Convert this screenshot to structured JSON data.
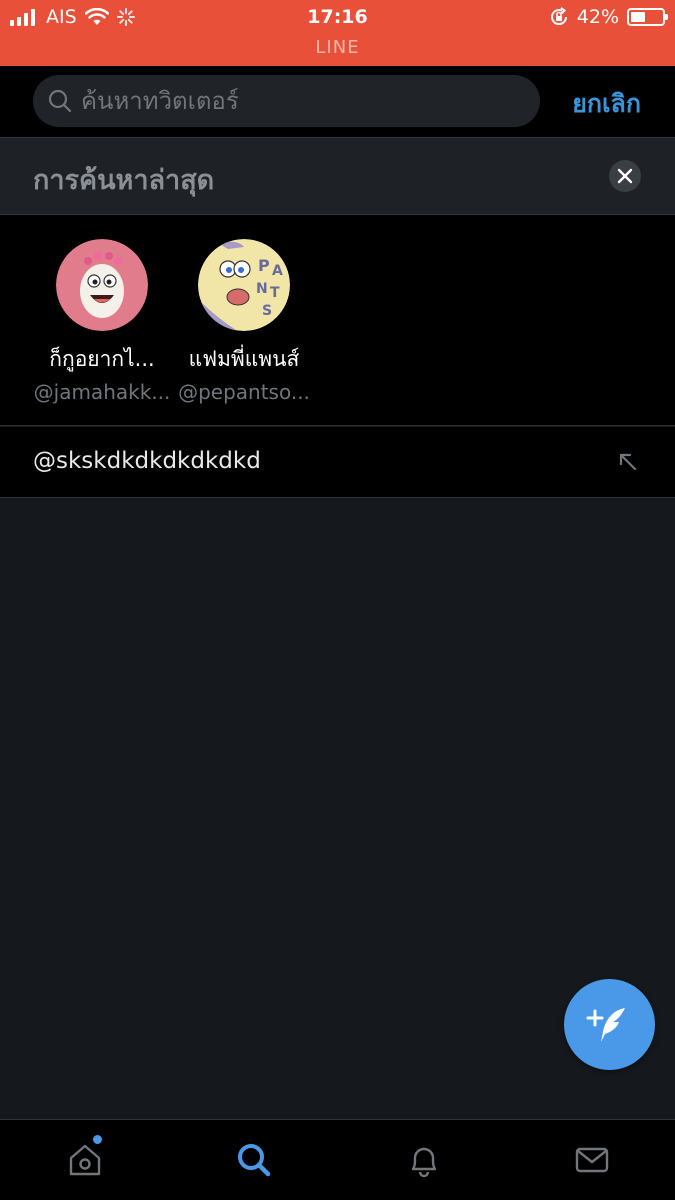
{
  "status_bar": {
    "carrier": "AIS",
    "time": "17:16",
    "app_name": "LINE",
    "battery_percent": "42%",
    "battery_level": 0.42,
    "bg_color": "#e8503a"
  },
  "search": {
    "placeholder": "ค้นหาทวิตเตอร์",
    "value": "",
    "cancel_label": "ยกเลิก"
  },
  "recent": {
    "title": "การค้นหาล่าสุด",
    "users": [
      {
        "name": "ก็กูอยากไ...",
        "handle": "@jamahakk..."
      },
      {
        "name": "แฟมพี่แพนส์",
        "handle": "@pepantso..."
      }
    ],
    "queries": [
      {
        "text": "@skskdkdkdkdkdkd"
      }
    ]
  },
  "tabs": [
    {
      "icon": "home-icon",
      "has_badge": true
    },
    {
      "icon": "search-icon",
      "active": true
    },
    {
      "icon": "bell-icon"
    },
    {
      "icon": "mail-icon"
    }
  ],
  "colors": {
    "accent": "#4a99e9",
    "background": "#15181c",
    "secondary_text": "#71767b"
  }
}
